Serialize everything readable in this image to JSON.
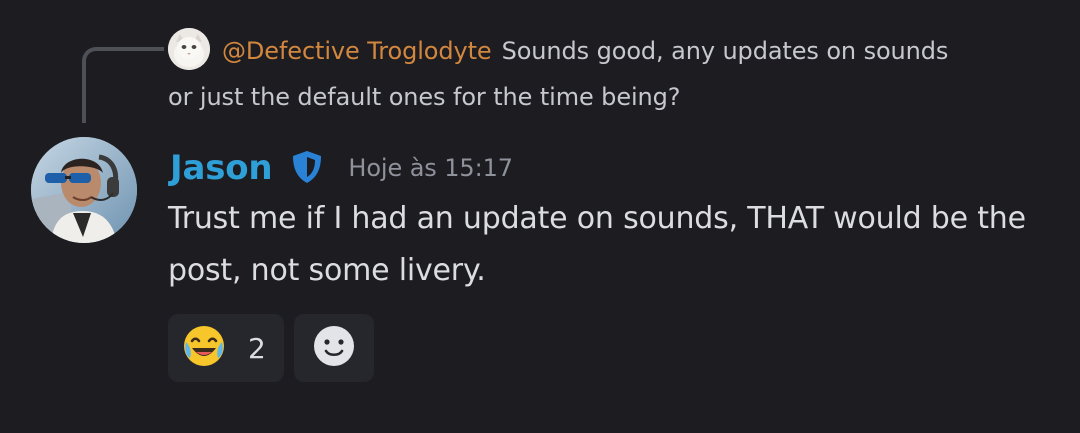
{
  "reply": {
    "mention": "@Defective Troglodyte",
    "text_line1": "Sounds good, any updates on sounds",
    "text_line2": "or just the default ones for the time being?"
  },
  "message": {
    "author": "Jason",
    "timestamp": "Hoje às 15:17",
    "content": "Trust me if I had an update on sounds, THAT would be the post, not some livery."
  },
  "reactions": [
    {
      "emoji": "joy-emoji-icon",
      "count": "2"
    }
  ],
  "icons": {
    "badge": "shield-icon",
    "add_reaction": "smiley-icon"
  },
  "colors": {
    "background": "#1c1c21",
    "username": "#2f9fd8",
    "mention": "#d2873f",
    "reaction_bg": "#26272d"
  }
}
